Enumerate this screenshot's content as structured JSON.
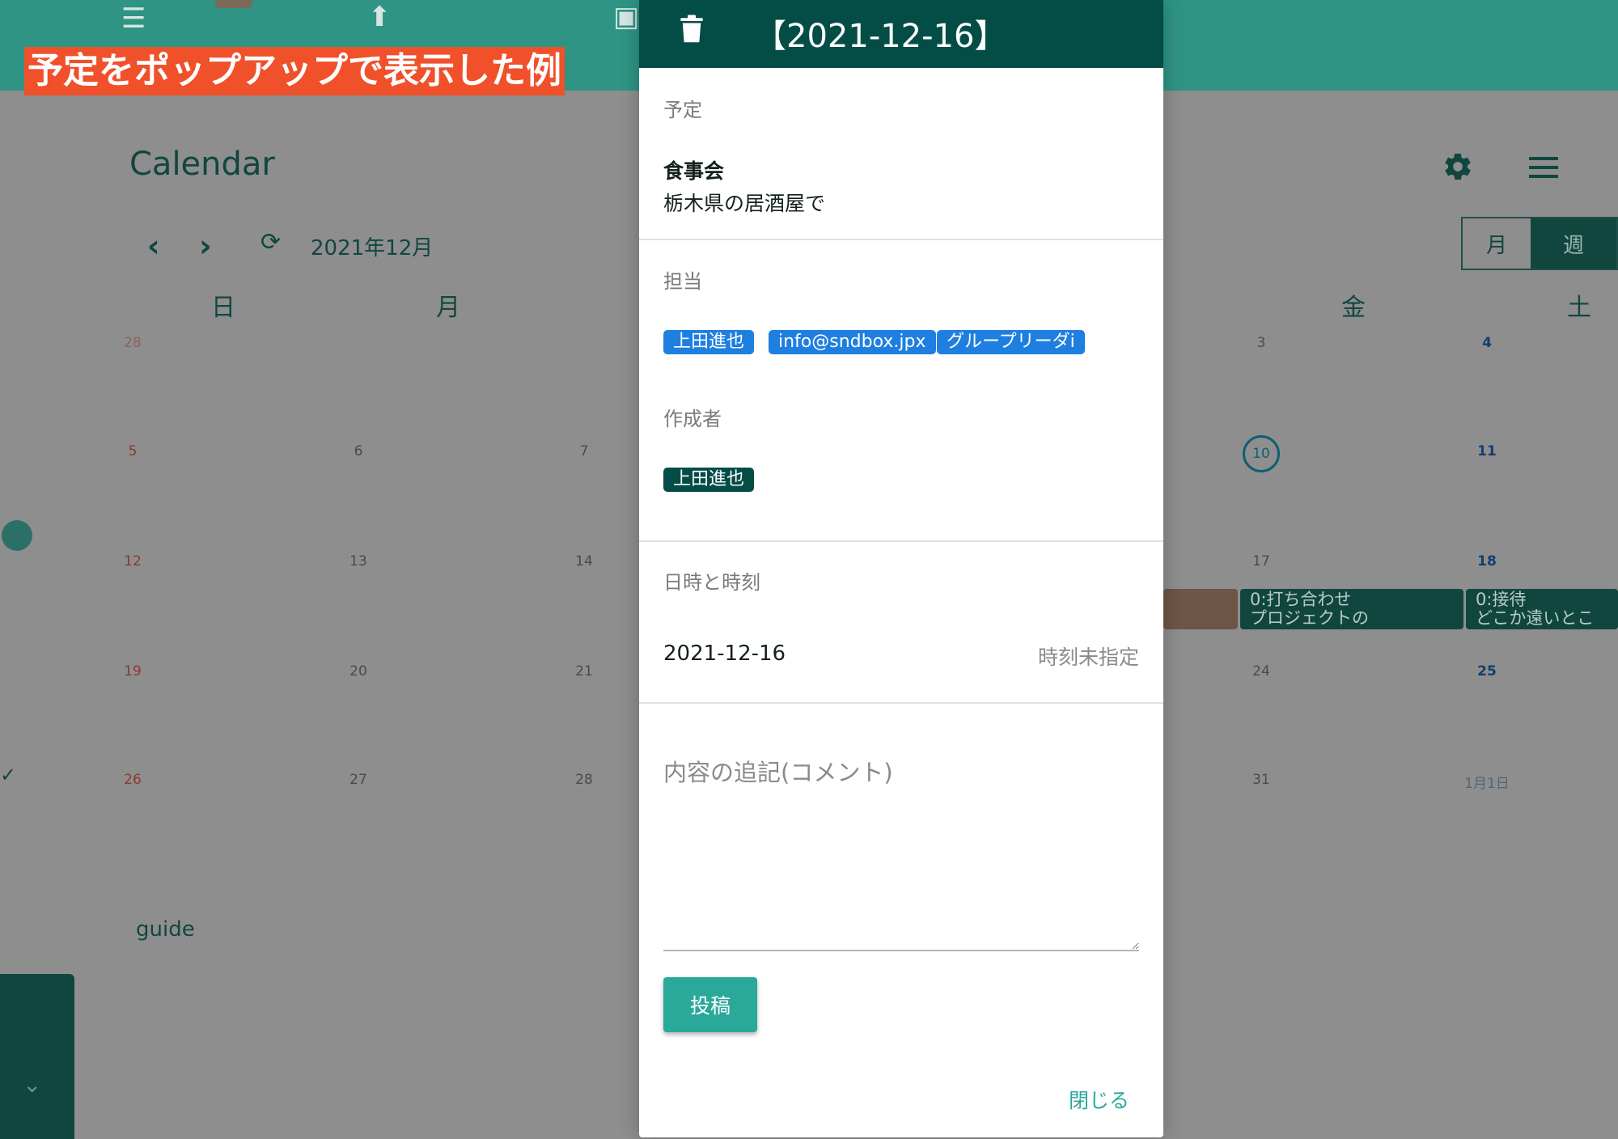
{
  "caption": "予定をポップアップで表示した例",
  "app": {
    "title": "Calendar",
    "month": "2021年12月",
    "view_month": "月",
    "view_week": "週",
    "guide": "guide"
  },
  "weekday_headers": [
    "日",
    "月",
    "金",
    "土"
  ],
  "calendar_days": {
    "sun": [
      "28",
      "5",
      "12",
      "19",
      "26"
    ],
    "mon": [
      "6",
      "13",
      "20",
      "27"
    ],
    "tue": [
      "7",
      "14",
      "21",
      "28"
    ],
    "fri": [
      "3",
      "10",
      "17",
      "24",
      "31"
    ],
    "sat": [
      "4",
      "11",
      "18",
      "25",
      "1月1日"
    ]
  },
  "calendar_events": [
    {
      "time_title": "0:打ち合わせ",
      "detail": "プロジェクトの"
    },
    {
      "time_title": "0:接待",
      "detail": "どこか遠いとこ"
    }
  ],
  "modal": {
    "header_title": "【2021-12-16】",
    "section_schedule": "予定",
    "event_title": "食事会",
    "event_description": "栃木県の居酒屋で",
    "section_assignee": "担当",
    "assignees": [
      "上田進也",
      "info@sndbox.jpx",
      "グループリーダi"
    ],
    "section_creator": "作成者",
    "creator": "上田進也",
    "section_datetime": "日時と時刻",
    "date": "2021-12-16",
    "time": "時刻未指定",
    "comment_placeholder": "内容の追記(コメント)",
    "post_button": "投稿",
    "close_button": "閉じる"
  },
  "colors": {
    "header": "#034d46",
    "chip_blue": "#1e7fe0",
    "accent": "#2aa99a",
    "caption_bg": "#f0502a"
  },
  "icons": [
    "list-icon",
    "upload-icon",
    "calendar-icon",
    "gear-icon",
    "hamburger-icon",
    "trash-icon",
    "chevron-left-icon",
    "chevron-right-icon",
    "refresh-icon"
  ]
}
